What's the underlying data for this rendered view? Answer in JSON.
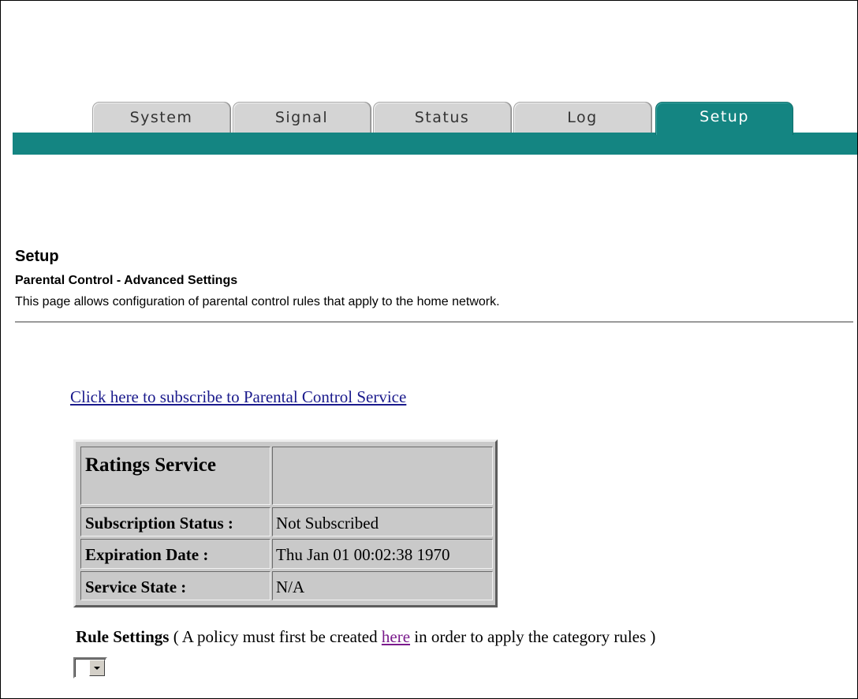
{
  "tabs": [
    {
      "label": "System"
    },
    {
      "label": "Signal"
    },
    {
      "label": "Status"
    },
    {
      "label": "Log"
    },
    {
      "label": "Setup",
      "active": true
    }
  ],
  "page": {
    "heading": "Setup",
    "subheading": "Parental Control - Advanced Settings",
    "description": "This page allows configuration of parental control rules that apply to the home network."
  },
  "subscribe_link": "Click here to subscribe to Parental Control Service",
  "ratings": {
    "header": "Ratings Service",
    "rows": [
      {
        "label": "Subscription Status :",
        "value": "Not Subscribed"
      },
      {
        "label": "Expiration Date :",
        "value": "Thu Jan 01 00:02:38 1970"
      },
      {
        "label": "Service State :",
        "value": "N/A"
      }
    ]
  },
  "rule_settings": {
    "label": "Rule Settings",
    "note_before": " ( A policy must first be created ",
    "link": "here",
    "note_after": " in order to apply the category rules )"
  },
  "policy_select": {
    "value": ""
  },
  "colors": {
    "accent": "#148582",
    "tab_inactive": "#d4d4d4",
    "table_bg": "#c9c9c9",
    "link": "#1a1a8c",
    "visited_link": "#7a1a8c"
  }
}
